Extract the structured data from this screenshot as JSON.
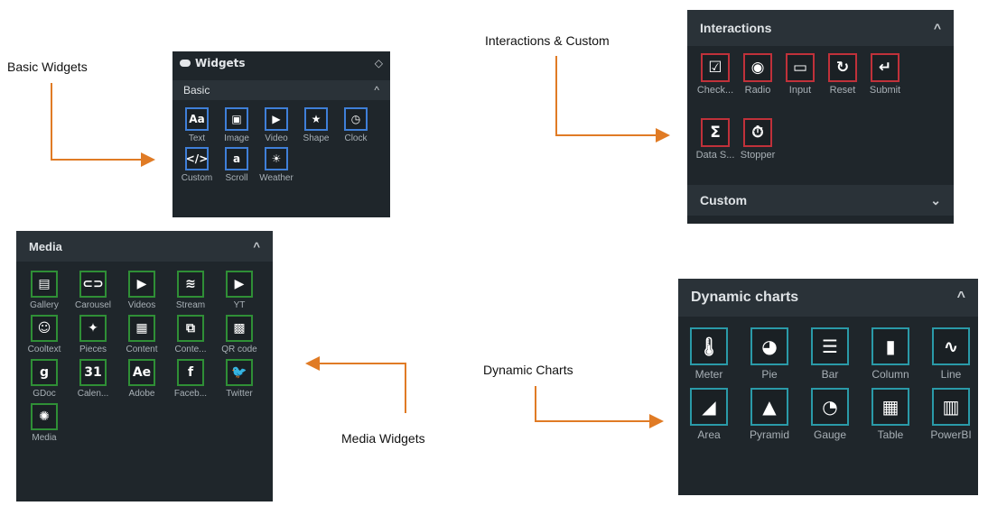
{
  "captions": {
    "basic": "Basic Widgets",
    "interactions": "Interactions & Custom",
    "media": "Media Widgets",
    "dynamic": "Dynamic Charts"
  },
  "colors": {
    "panel_bg": "#1f262b",
    "basic_border": "#3f7fd8",
    "interactions_border": "#c0313a",
    "media_border": "#2f8f36",
    "charts_border": "#2a9aa8",
    "arrow": "#e07b25"
  },
  "basic_panel": {
    "title": "Widgets",
    "title_icon": "toggle-icon",
    "section": "Basic",
    "section_chevron": "^",
    "items": [
      {
        "label": "Text",
        "icon": "text-icon",
        "glyph": "Aa"
      },
      {
        "label": "Image",
        "icon": "image-icon",
        "glyph": "▣"
      },
      {
        "label": "Video",
        "icon": "video-icon",
        "glyph": "▶"
      },
      {
        "label": "Shape",
        "icon": "star-icon",
        "glyph": "★"
      },
      {
        "label": "Clock",
        "icon": "clock-icon",
        "glyph": "◷"
      },
      {
        "label": "Custom",
        "icon": "code-icon",
        "glyph": "</>"
      },
      {
        "label": "Scroll",
        "icon": "scroll-icon",
        "glyph": "a"
      },
      {
        "label": "Weather",
        "icon": "sun-icon",
        "glyph": "☀"
      }
    ]
  },
  "interactions_panel": {
    "section": "Interactions",
    "section_chevron": "^",
    "items": [
      {
        "label": "Check...",
        "icon": "checkbox-icon",
        "glyph": "☑"
      },
      {
        "label": "Radio",
        "icon": "radio-icon",
        "glyph": "◉"
      },
      {
        "label": "Input",
        "icon": "input-icon",
        "glyph": "▭"
      },
      {
        "label": "Reset",
        "icon": "reset-icon",
        "glyph": "↻"
      },
      {
        "label": "Submit",
        "icon": "submit-icon",
        "glyph": "↵"
      },
      {
        "label": "Data S...",
        "icon": "sigma-icon",
        "glyph": "Σ"
      },
      {
        "label": "Stopper",
        "icon": "stopwatch-icon",
        "glyph": "⏱"
      }
    ],
    "custom_section": "Custom",
    "custom_chevron": "⌄"
  },
  "media_panel": {
    "section": "Media",
    "section_chevron": "^",
    "items": [
      {
        "label": "Gallery",
        "icon": "gallery-icon",
        "glyph": "▤"
      },
      {
        "label": "Carousel",
        "icon": "carousel-icon",
        "glyph": "⊂⊃"
      },
      {
        "label": "Videos",
        "icon": "videos-icon",
        "glyph": "▶"
      },
      {
        "label": "Stream",
        "icon": "wifi-icon",
        "glyph": "≋"
      },
      {
        "label": "YT",
        "icon": "youtube-icon",
        "glyph": "▶"
      },
      {
        "label": "Cooltext",
        "icon": "cool-face-icon",
        "glyph": "☺"
      },
      {
        "label": "Pieces",
        "icon": "puzzle-icon",
        "glyph": "✦"
      },
      {
        "label": "Content",
        "icon": "content-icon",
        "glyph": "▦"
      },
      {
        "label": "Conte...",
        "icon": "content-share-icon",
        "glyph": "⧉"
      },
      {
        "label": "QR code",
        "icon": "qr-code-icon",
        "glyph": "▩"
      },
      {
        "label": "GDoc",
        "icon": "google-icon",
        "glyph": "g"
      },
      {
        "label": "Calen...",
        "icon": "calendar-icon",
        "glyph": "31"
      },
      {
        "label": "Adobe",
        "icon": "adobe-icon",
        "glyph": "Ae"
      },
      {
        "label": "Faceb...",
        "icon": "facebook-icon",
        "glyph": "f"
      },
      {
        "label": "Twitter",
        "icon": "twitter-icon",
        "glyph": "🐦"
      },
      {
        "label": "Media",
        "icon": "media-icon",
        "glyph": "✺"
      }
    ]
  },
  "charts_panel": {
    "section": "Dynamic charts",
    "section_chevron": "^",
    "items": [
      {
        "label": "Meter",
        "icon": "thermometer-icon",
        "glyph": "🌡"
      },
      {
        "label": "Pie",
        "icon": "pie-chart-icon",
        "glyph": "◕"
      },
      {
        "label": "Bar",
        "icon": "bar-chart-icon",
        "glyph": "☰"
      },
      {
        "label": "Column",
        "icon": "column-chart-icon",
        "glyph": "▮"
      },
      {
        "label": "Line",
        "icon": "line-chart-icon",
        "glyph": "∿"
      },
      {
        "label": "Area",
        "icon": "area-chart-icon",
        "glyph": "◢"
      },
      {
        "label": "Pyramid",
        "icon": "pyramid-icon",
        "glyph": "▲"
      },
      {
        "label": "Gauge",
        "icon": "gauge-icon",
        "glyph": "◔"
      },
      {
        "label": "Table",
        "icon": "table-icon",
        "glyph": "▦"
      },
      {
        "label": "PowerBI",
        "icon": "powerbi-icon",
        "glyph": "▥"
      }
    ]
  }
}
